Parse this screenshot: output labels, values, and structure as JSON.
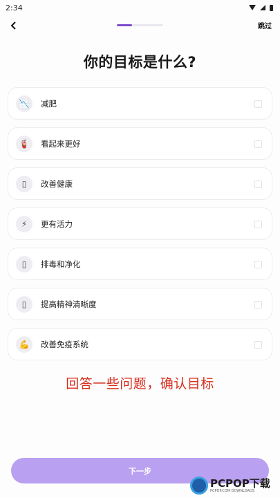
{
  "status_bar": {
    "time": "2:34"
  },
  "header": {
    "back_icon": "chevron-left-icon",
    "skip_label": "跳过",
    "progress_fraction": 0.33,
    "accent_color": "#7c4dcc"
  },
  "page_title": "你的目标是什么?",
  "goals": [
    {
      "label": "减肥",
      "icon": "chart-down-icon",
      "glyph": "📉"
    },
    {
      "label": "看起来更好",
      "icon": "fire-extinguisher-icon",
      "glyph": "🧯"
    },
    {
      "label": "改善健康",
      "icon": "health-icon",
      "glyph": "▯"
    },
    {
      "label": "更有活力",
      "icon": "lightning-icon",
      "glyph": "⚡"
    },
    {
      "label": "排毒和净化",
      "icon": "detox-icon",
      "glyph": "▯"
    },
    {
      "label": "提高精神清晰度",
      "icon": "mind-icon",
      "glyph": "▯"
    },
    {
      "label": "改善免疫系统",
      "icon": "flexed-arm-icon",
      "glyph": "💪"
    }
  ],
  "overlay_caption": "回答一些问题，确认目标",
  "next_button_label": "下一步",
  "next_button_color": "#b9a0f0",
  "watermark": {
    "text": "PCPOP下载",
    "sub": "PCPOP.COM DOWNLOADS"
  }
}
